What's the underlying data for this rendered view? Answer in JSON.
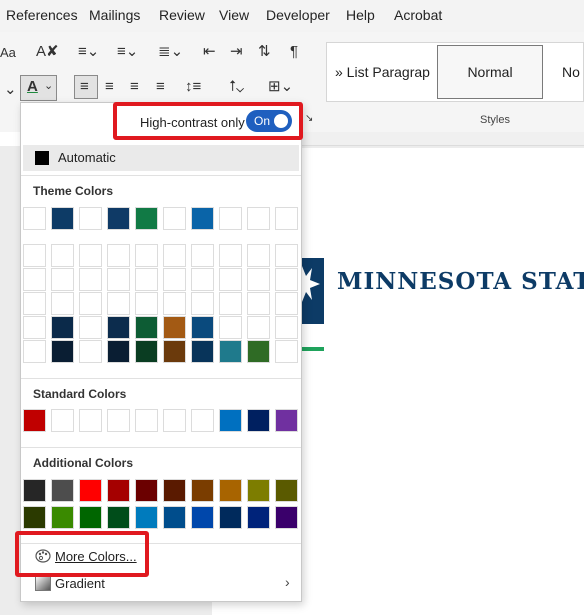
{
  "menubar": {
    "items": [
      "References",
      "Mailings",
      "Review",
      "View",
      "Developer",
      "Help",
      "Acrobat"
    ]
  },
  "ribbon": {
    "styles_gallery": {
      "list_paragraph": "» List Paragrap",
      "normal": "Normal",
      "no_spacing": "No"
    },
    "styles_group_label": "Styles",
    "partial_label_left": "Aa"
  },
  "document": {
    "logo_text": "MINNESOTA STATE"
  },
  "dropdown": {
    "high_contrast_label": "High-contrast only",
    "toggle_state": "On",
    "automatic_label": "Automatic",
    "theme_colors_title": "Theme Colors",
    "standard_colors_title": "Standard Colors",
    "additional_colors_title": "Additional Colors",
    "more_colors_label": "More Colors...",
    "gradient_label": "Gradient",
    "theme_top_row": [
      "#ffffff",
      "#0d3b66",
      "#ffffff",
      "#0f3a66",
      "#117a45",
      "#ffffff",
      "#0a64a8",
      "#ffffff",
      "#ffffff",
      "#ffffff"
    ],
    "theme_shades": [
      [
        "#ffffff",
        "#ffffff",
        "#ffffff",
        "#ffffff",
        "#ffffff",
        "#ffffff",
        "#ffffff",
        "#ffffff",
        "#ffffff",
        "#ffffff"
      ],
      [
        "#ffffff",
        "#ffffff",
        "#ffffff",
        "#ffffff",
        "#ffffff",
        "#ffffff",
        "#ffffff",
        "#ffffff",
        "#ffffff",
        "#ffffff"
      ],
      [
        "#ffffff",
        "#ffffff",
        "#ffffff",
        "#ffffff",
        "#ffffff",
        "#ffffff",
        "#ffffff",
        "#ffffff",
        "#ffffff",
        "#ffffff"
      ],
      [
        "#ffffff",
        "#0b2a4a",
        "#ffffff",
        "#0c2c4d",
        "#0d5c34",
        "#a35a14",
        "#0a4a7d",
        "#ffffff",
        "#ffffff",
        "#ffffff"
      ],
      [
        "#ffffff",
        "#0a1e33",
        "#ffffff",
        "#0a1e33",
        "#0a3d22",
        "#6b3a0c",
        "#08345a",
        "#1f7a8c",
        "#2f6b25",
        "#ffffff"
      ]
    ],
    "standard_colors": [
      "#c00000",
      "#ffffff",
      "#ffffff",
      "#ffffff",
      "#ffffff",
      "#ffffff",
      "#ffffff",
      "#0070c0",
      "#002060",
      "#7030a0"
    ],
    "additional_colors": [
      [
        "#262626",
        "#4d4d4d",
        "#ff0000",
        "#a50000",
        "#6b0000",
        "#5a1a00",
        "#7a3d00",
        "#a86400",
        "#7d7d00",
        "#5a5a00"
      ],
      [
        "#2b3a00",
        "#3a8a00",
        "#006600",
        "#004d1a",
        "#007bbd",
        "#004d8c",
        "#0047ab",
        "#002a5c",
        "#00237a",
        "#3a006b"
      ]
    ]
  }
}
